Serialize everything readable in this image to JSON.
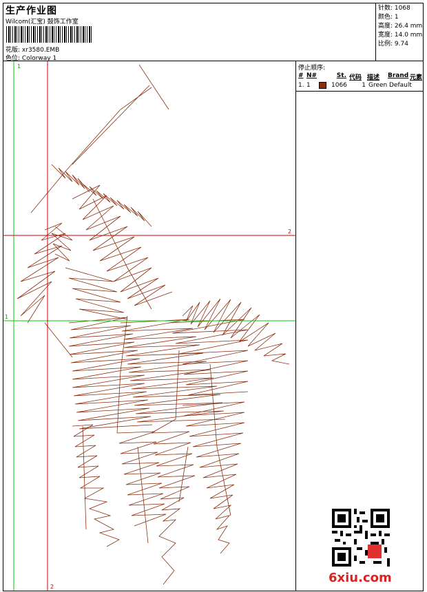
{
  "header": {
    "title": "生产作业图",
    "company": "Wilcom(汇宝) 鼓饰工作室",
    "design_file_label": "花版:",
    "design_file": "xr3580.EMB",
    "colorway_label": "色位:",
    "colorway": "Colorway 1"
  },
  "specs": {
    "stitches": "针数: 1068",
    "colors": "颜色: 1",
    "height": "高度: 26.4 mm",
    "width": "宽度: 14.0 mm",
    "scale": "比例: 9.74"
  },
  "stop_sequence": {
    "heading": "停止顺序:",
    "columns": [
      "#",
      "N#",
      "St.",
      "代码",
      "描述",
      "Brand",
      "元素"
    ],
    "rows": [
      {
        "num": "1.",
        "n": "1",
        "stitches": "1066",
        "code": "1",
        "desc": "Green",
        "brand": "Default",
        "swatch": "#8b2e0f"
      }
    ]
  },
  "guides": {
    "green_v": "1",
    "green_h": "1",
    "red_h": "2",
    "red_v": "2"
  },
  "colors": {
    "thread": "#8b2e0f",
    "green_guide": "#00cc00",
    "red_guide": "#cc0000"
  },
  "watermark": "6xiu.com"
}
